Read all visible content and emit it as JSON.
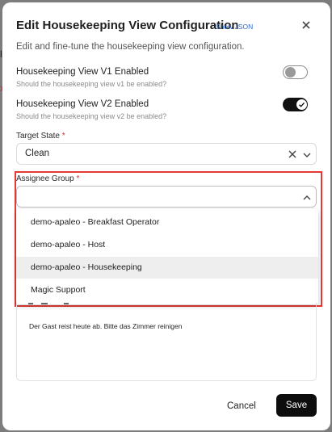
{
  "modal": {
    "title": "Edit Housekeeping View Configuration",
    "show_json_label": "Show JSON",
    "subtitle": "Edit and fine-tune the housekeeping view configuration."
  },
  "toggles": [
    {
      "label": "Housekeeping View V1 Enabled",
      "help": "Should the housekeeping view v1 be enabled?",
      "enabled": false
    },
    {
      "label": "Housekeeping View V2 Enabled",
      "help": "Should the housekeeping view v2 be enabled?",
      "enabled": true
    }
  ],
  "target_state": {
    "label": "Target State",
    "required_mark": "*",
    "value": "Clean"
  },
  "assignee_group": {
    "label": "Assignee Group",
    "required_mark": "*",
    "value": "",
    "options": [
      "demo-apaleo - Breakfast Operator",
      "demo-apaleo - Host",
      "demo-apaleo - Housekeeping",
      "Magic Support"
    ],
    "hovered_option": "demo-apaleo - Housekeeping"
  },
  "editor": {
    "text": "Der Gast reist heute ab. Bitte das Zimmer reinigen"
  },
  "footer": {
    "cancel_label": "Cancel",
    "save_label": "Save"
  },
  "colors": {
    "accent_link": "#2f6ccf",
    "highlight_border": "#e53935",
    "required": "#d32f2f",
    "primary_button": "#0d0d0d"
  },
  "backdrop": {
    "glyph_a": "lo",
    "glyph_b": "x"
  }
}
